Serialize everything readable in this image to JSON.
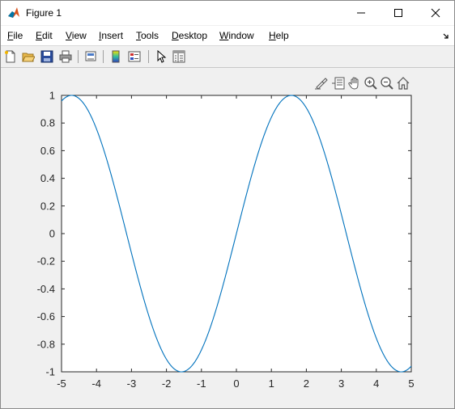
{
  "window": {
    "title": "Figure 1"
  },
  "menu": {
    "items": [
      {
        "label": "File",
        "u": "F",
        "rest": "ile"
      },
      {
        "label": "Edit",
        "u": "E",
        "rest": "dit"
      },
      {
        "label": "View",
        "u": "V",
        "rest": "iew"
      },
      {
        "label": "Insert",
        "u": "I",
        "rest": "nsert"
      },
      {
        "label": "Tools",
        "u": "T",
        "rest": "ools"
      },
      {
        "label": "Desktop",
        "u": "D",
        "rest": "esktop"
      },
      {
        "label": "Window",
        "u": "W",
        "rest": "indow"
      },
      {
        "label": "Help",
        "u": "H",
        "rest": "elp"
      }
    ]
  },
  "toolbar": {
    "icons": [
      "new-figure-icon",
      "open-file-icon",
      "save-icon",
      "print-icon",
      "link-plot-icon",
      "colorbar-icon",
      "legend-icon",
      "edit-plot-icon",
      "property-inspector-icon"
    ]
  },
  "axes_toolbar": {
    "icons": [
      "brush-icon",
      "data-tips-icon",
      "pan-icon",
      "zoom-in-icon",
      "zoom-out-icon",
      "home-icon"
    ]
  },
  "chart_data": {
    "type": "line",
    "function": "sin(x)",
    "xlim": [
      -5,
      5
    ],
    "ylim": [
      -1,
      1
    ],
    "xticks": [
      "-5",
      "-4",
      "-3",
      "-2",
      "-1",
      "0",
      "1",
      "2",
      "3",
      "4",
      "5"
    ],
    "yticks": [
      "1",
      "0.8",
      "0.6",
      "0.4",
      "0.2",
      "0",
      "-0.2",
      "-0.4",
      "-0.6",
      "-0.8",
      "-1"
    ],
    "line_color": "#0072BD",
    "grid": false
  }
}
